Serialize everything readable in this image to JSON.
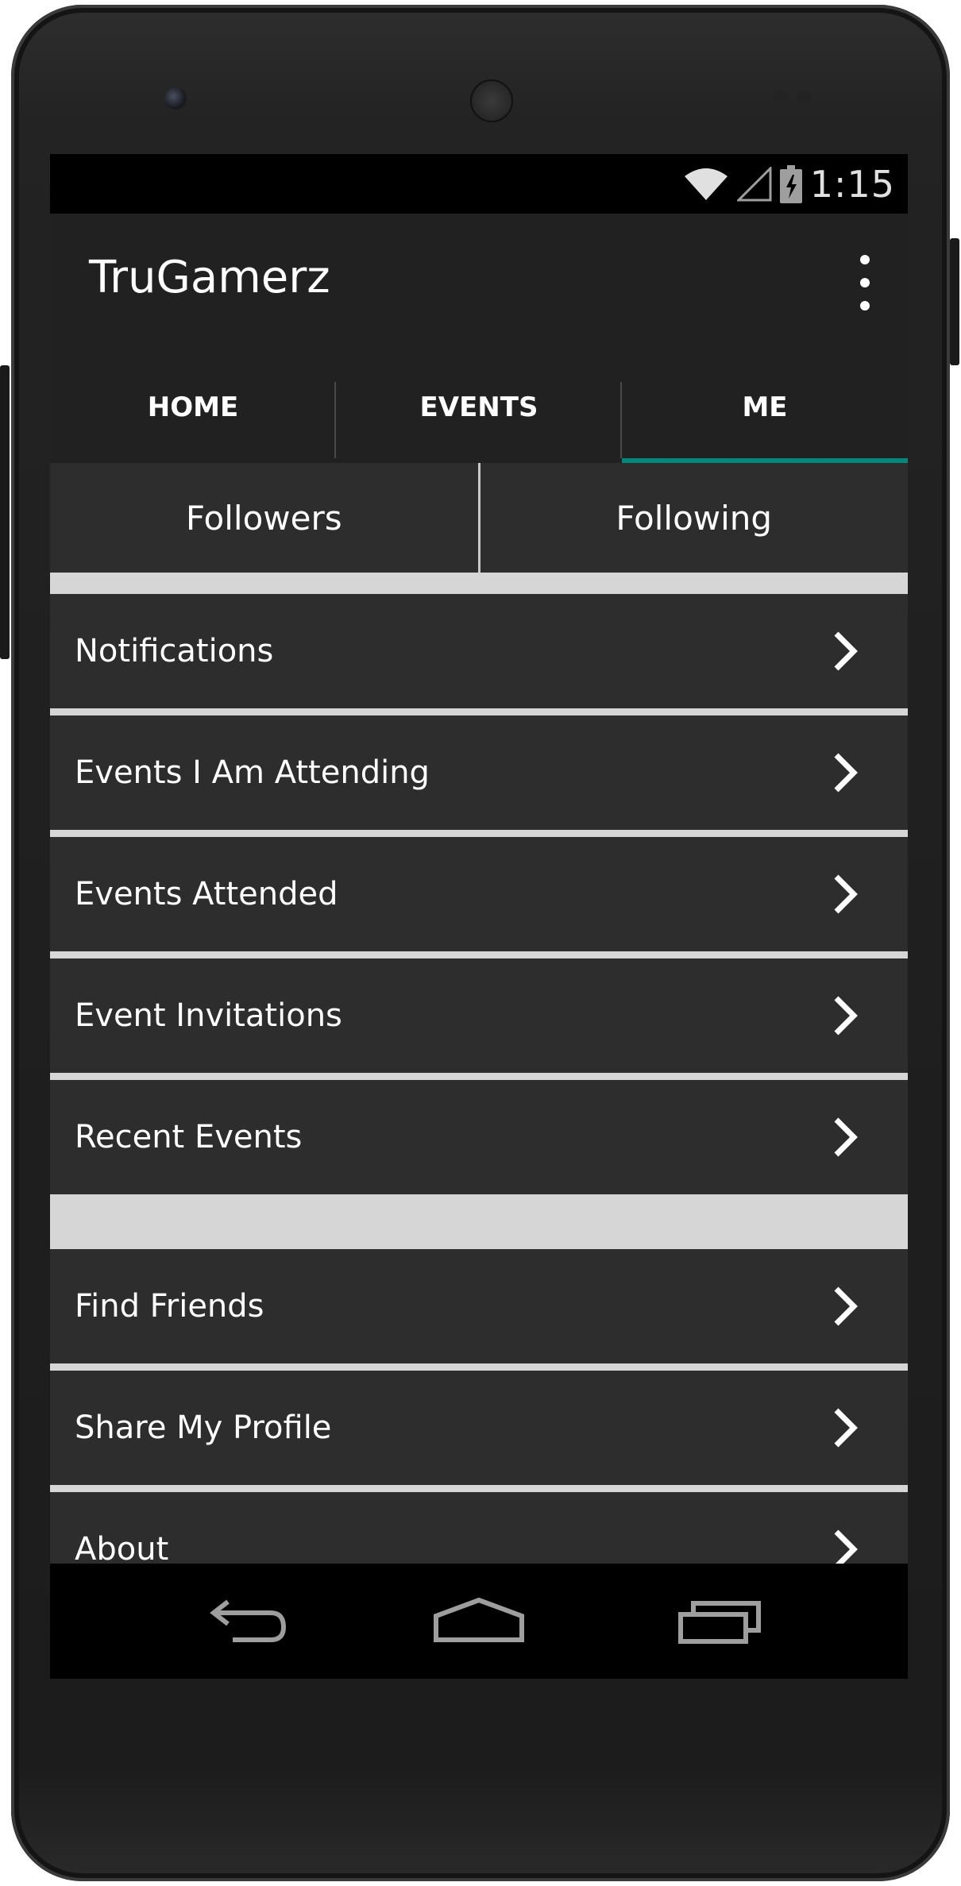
{
  "status_bar": {
    "time": "1:15",
    "icons": [
      "wifi-icon",
      "cell-signal-icon",
      "battery-charging-icon"
    ]
  },
  "app_bar": {
    "title": "TruGamerz",
    "overflow_icon": "more-vert-icon"
  },
  "tabs": [
    {
      "label": "HOME",
      "selected": false
    },
    {
      "label": "EVENTS",
      "selected": false
    },
    {
      "label": "ME",
      "selected": true
    }
  ],
  "follow": {
    "followers_label": "Followers",
    "following_label": "Following"
  },
  "menu_section_1": [
    {
      "label": "Notifications",
      "icon": "chevron-right-icon"
    },
    {
      "label": "Events I Am Attending",
      "icon": "chevron-right-icon"
    },
    {
      "label": "Events Attended",
      "icon": "chevron-right-icon"
    },
    {
      "label": "Event Invitations",
      "icon": "chevron-right-icon"
    },
    {
      "label": "Recent Events",
      "icon": "chevron-right-icon"
    }
  ],
  "menu_section_2": [
    {
      "label": "Find Friends",
      "icon": "chevron-right-icon"
    },
    {
      "label": "Share My Profile",
      "icon": "chevron-right-icon"
    },
    {
      "label": "About",
      "icon": "chevron-right-icon"
    }
  ],
  "nav_bar": {
    "icons": [
      "back-icon",
      "home-icon",
      "recents-icon"
    ]
  },
  "colors": {
    "tab_indicator": "#00897b",
    "app_bar": "#212121",
    "list_item": "#2d2d2d",
    "separator": "#d6d6d6"
  }
}
